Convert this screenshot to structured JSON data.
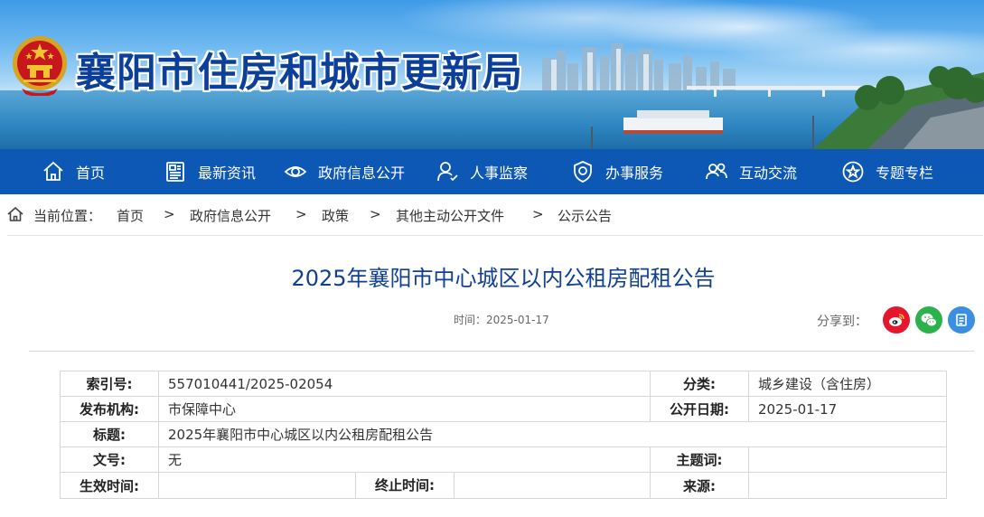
{
  "header": {
    "site_title": "襄阳市住房和城市更新局"
  },
  "nav": {
    "items": [
      {
        "label": "首页",
        "icon": "home-icon"
      },
      {
        "label": "最新资讯",
        "icon": "news-icon"
      },
      {
        "label": "政府信息公开",
        "icon": "eye-icon"
      },
      {
        "label": "人事监察",
        "icon": "person-icon"
      },
      {
        "label": "办事服务",
        "icon": "shield-icon"
      },
      {
        "label": "互动交流",
        "icon": "users-icon"
      },
      {
        "label": "专题专栏",
        "icon": "star-icon"
      }
    ]
  },
  "breadcrumb": {
    "prefix": "当前位置：",
    "items": [
      "首页",
      "政府信息公开",
      "政策",
      "其他主动公开文件",
      "公示公告"
    ],
    "separator": ">"
  },
  "article": {
    "title": "2025年襄阳市中心城区以内公租房配租公告",
    "time_label": "时间：2025-01-17",
    "share_label": "分享到："
  },
  "share": {
    "weibo_color": "#e6162d",
    "wechat_color": "#2bb24c",
    "other_color": "#3b8ee0"
  },
  "info": {
    "index_label": "索引号:",
    "index_value": "557010441/2025-02054",
    "category_label": "分类:",
    "category_value": "城乡建设（含住房）",
    "org_label": "发布机构:",
    "org_value": "市保障中心",
    "open_date_label": "公开日期:",
    "open_date_value": "2025-01-17",
    "title_label": "标题:",
    "title_value": "2025年襄阳市中心城区以内公租房配租公告",
    "docno_label": "文号:",
    "docno_value": "无",
    "subject_label": "主题词:",
    "subject_value": "",
    "effective_label": "生效时间:",
    "effective_value": "",
    "expire_label": "终止时间:",
    "expire_value": "",
    "source_label": "来源:",
    "source_value": ""
  },
  "colors": {
    "nav_bg": "#0d58b4",
    "title_blue": "#10408f"
  }
}
